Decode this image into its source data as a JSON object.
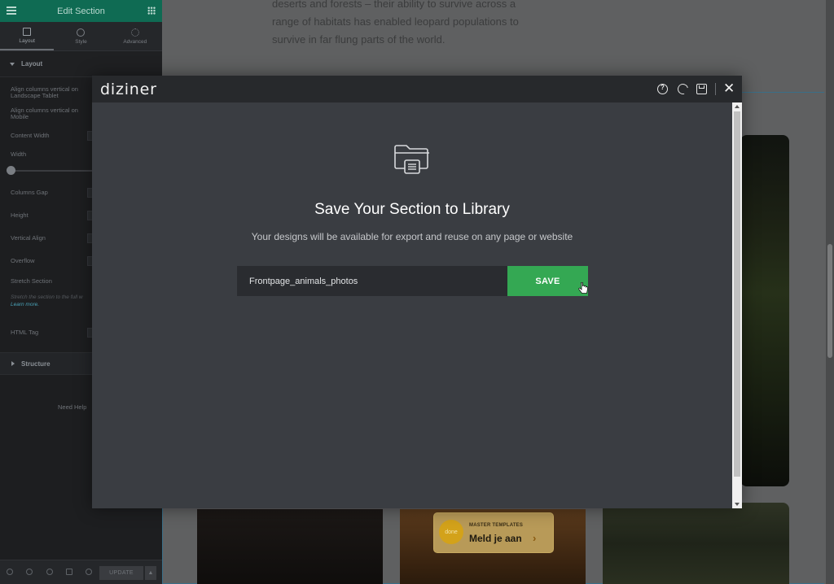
{
  "editor_panel": {
    "header_title": "Edit Section",
    "tabs": [
      {
        "label": "Layout",
        "icon": "columns-icon"
      },
      {
        "label": "Style",
        "icon": "half-circle-icon"
      },
      {
        "label": "Advanced",
        "icon": "gear-icon"
      }
    ],
    "layout_section": "Layout",
    "controls": {
      "align_tablet": "Align columns vertical on Landscape Tablet",
      "align_mobile": "Align columns vertical on Mobile",
      "content_width": "Content Width",
      "width": "Width",
      "columns_gap": "Columns Gap",
      "height": "Height",
      "vertical_align": "Vertical Align",
      "overflow": "Overflow",
      "stretch_section": "Stretch Section",
      "stretch_hint": "Stretch the section to the full w",
      "learn_more": "Learn more.",
      "html_tag": "HTML Tag"
    },
    "structure_section": "Structure",
    "need_help": "Need Help",
    "update_label": "UPDATE"
  },
  "page_preview": {
    "body_text": "deserts and forests – their ability to survive across a range of habitats has enabled leopard populations to survive in far flung parts of the world.",
    "badge_top": "MASTER TEMPLATES",
    "badge_main": "Meld je aan",
    "badge_logo": "done"
  },
  "modal": {
    "brand": "diziner",
    "title": "Save Your Section to Library",
    "subtitle": "Your designs will be available for export and reuse on any page or website",
    "input_value": "Frontpage_animals_photos",
    "save_label": "SAVE",
    "accent_color": "#34a853"
  }
}
